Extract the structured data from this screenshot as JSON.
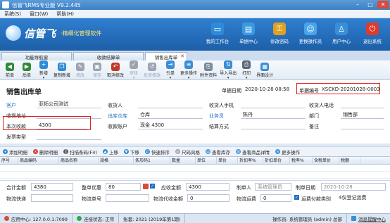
{
  "window": {
    "title": "信管飞RMS专业版 V9.2.445"
  },
  "menu": [
    "系统(S)",
    "窗口(W)",
    "帮助(H)"
  ],
  "brand": {
    "name": "信管飞",
    "slogan": "·精细化管理软件"
  },
  "topnav": [
    {
      "label": "我的工作台",
      "icon": "desktop-icon",
      "color": "#2e8bd8"
    },
    {
      "label": "单据中心",
      "icon": "documents-icon",
      "color": "#3a9ae0"
    },
    {
      "label": "修改密码",
      "icon": "key-icon",
      "color": "#e0a020"
    },
    {
      "label": "更换操作员",
      "icon": "users-icon",
      "color": "#4aa4e8"
    },
    {
      "label": "用户中心",
      "icon": "user-center-icon",
      "color": "#3a8ed8"
    },
    {
      "label": "退出系统",
      "icon": "power-icon",
      "color": "#e03a2a"
    }
  ],
  "tabs": [
    "功能导航窗",
    "收款结算单",
    "销售出库单"
  ],
  "toolbar": [
    {
      "label": "前单",
      "icon": "arrow-left-icon",
      "color": "#2f8a3a",
      "disabled": false
    },
    {
      "label": "后单",
      "icon": "arrow-right-icon",
      "color": "#2f8a3a",
      "disabled": false
    },
    {
      "label": "新增",
      "icon": "add-icon",
      "color": "#2e8bd8",
      "disabled": false,
      "dropdown": true
    },
    {
      "label": "复制新增",
      "icon": "copy-icon",
      "color": "#2e8bd8",
      "disabled": false
    },
    {
      "label": "修改",
      "icon": "edit-icon",
      "color": "#9aa5b3",
      "disabled": true
    },
    {
      "label": "保存",
      "icon": "save-icon",
      "color": "#9aa5b3",
      "disabled": true
    },
    {
      "label": "取消修改",
      "icon": "undo-icon",
      "color": "#c0392b",
      "disabled": false
    },
    {
      "label": "审核",
      "icon": "approve-icon",
      "color": "#9aa5b3",
      "disabled": true,
      "dropdown": true
    },
    {
      "label": "反审修改",
      "icon": "unapprove-icon",
      "color": "#9aa5b3",
      "disabled": true
    },
    {
      "label": "引单",
      "icon": "import-order-icon",
      "color": "#3a8ed8",
      "disabled": false,
      "dropdown": true
    },
    {
      "label": "更多操作",
      "icon": "more-icon",
      "color": "#3a8ed8",
      "disabled": false,
      "dropdown": true
    },
    {
      "label": "附件资料",
      "icon": "attachment-icon",
      "color": "#7a8898",
      "disabled": false
    },
    {
      "label": "导入导出",
      "icon": "import-export-icon",
      "color": "#3a8ed8",
      "disabled": false,
      "dropdown": true
    },
    {
      "label": "打印",
      "icon": "print-icon",
      "color": "#5a6878",
      "disabled": false,
      "dropdown": true
    },
    {
      "label": "界面设计",
      "icon": "design-icon",
      "color": "#3a8ed8",
      "disabled": false
    }
  ],
  "form": {
    "title": "销售出库单",
    "date_label": "单据日期",
    "date_value": "2020-10-28 08:58",
    "number_label": "单据编号",
    "number_value": "XSCKD-20201028-0003",
    "customer_label": "客户",
    "customer_value": "亚拓公司测试",
    "receiver_label": "收货人",
    "receiver_value": "",
    "receiver_phone_label": "收货人手机",
    "receiver_phone_value": "",
    "receiver_tel_label": "收货人电话",
    "receiver_tel_value": "",
    "address_label": "收货地址",
    "address_value": "",
    "warehouse_label": "出库仓库",
    "warehouse_value": "仓库",
    "salesman_label": "业务员",
    "salesman_value": "陈丹",
    "dept_label": "部门",
    "dept_value": "销售部",
    "received_label": "本次收款",
    "received_value": "4300",
    "account_label": "收款账户",
    "account_value": "现金 4300",
    "settle_label": "结算方式",
    "settle_value": "",
    "remark_label": "备注",
    "remark_value": "",
    "ship_type_label": "发票类型",
    "ship_type_value": ""
  },
  "gridbar": [
    {
      "label": "添加明细",
      "icon": "add-row-icon",
      "color": "#2e8bd8"
    },
    {
      "label": "删除明细",
      "icon": "delete-row-icon",
      "color": "#d93a2a"
    },
    {
      "label": "扫描条码(F4)",
      "icon": "barcode-icon",
      "color": "#555555"
    },
    {
      "label": "上移",
      "icon": "move-up-icon",
      "color": "#2e8bd8"
    },
    {
      "label": "下移",
      "icon": "move-down-icon",
      "color": "#2e8bd8"
    },
    {
      "label": "快速排序",
      "icon": "sort-icon",
      "color": "#2e8bd8"
    },
    {
      "label": "尺码风格",
      "icon": "size-style-icon",
      "color": "#9aa5b3"
    },
    {
      "label": "查看库存",
      "icon": "stock-icon",
      "color": "#3a8ed8"
    },
    {
      "label": "查看商品详情",
      "icon": "product-detail-icon",
      "color": "#3a8ed8"
    },
    {
      "label": "更多操作",
      "icon": "more-icon",
      "color": "#3a8ed8"
    }
  ],
  "grid": {
    "columns": [
      "序号",
      "商品编码",
      "商品名称",
      "规格",
      "条形码1",
      "数量",
      "单位",
      "单价",
      "折扣率%",
      "折扣单价",
      "税率%",
      "含税单价",
      "税额"
    ]
  },
  "totals": {
    "total_qty_label": "合计金额",
    "total_qty_value": "4380",
    "discount_label": "整单优惠",
    "discount_value": "80",
    "receivable_label": "应收金额",
    "receivable_value": "4300",
    "creator_label": "制单人",
    "creator_value": "系统管理员",
    "create_date_label": "制单日期",
    "create_date_value": "2020-10-28",
    "logistics_label": "物流快递",
    "logistics_value": "",
    "tracking_label": "物流单号",
    "tracking_value": "",
    "cod_label": "物流代收金额",
    "cod_value": "0",
    "freight_label": "物流运费",
    "freight_value": "0",
    "freight_pay_label": "运费付款类别",
    "freight_pay_value": "4仅登记运费"
  },
  "status": {
    "app_center": "应用中心: 127.0.0.1:7099",
    "connection": "连接状态: 正常",
    "year": "账套: 2021 (2019年第1期)",
    "operator": "操作员: 系统管理员 (admin) 总部",
    "message": "消息提醒中心"
  }
}
